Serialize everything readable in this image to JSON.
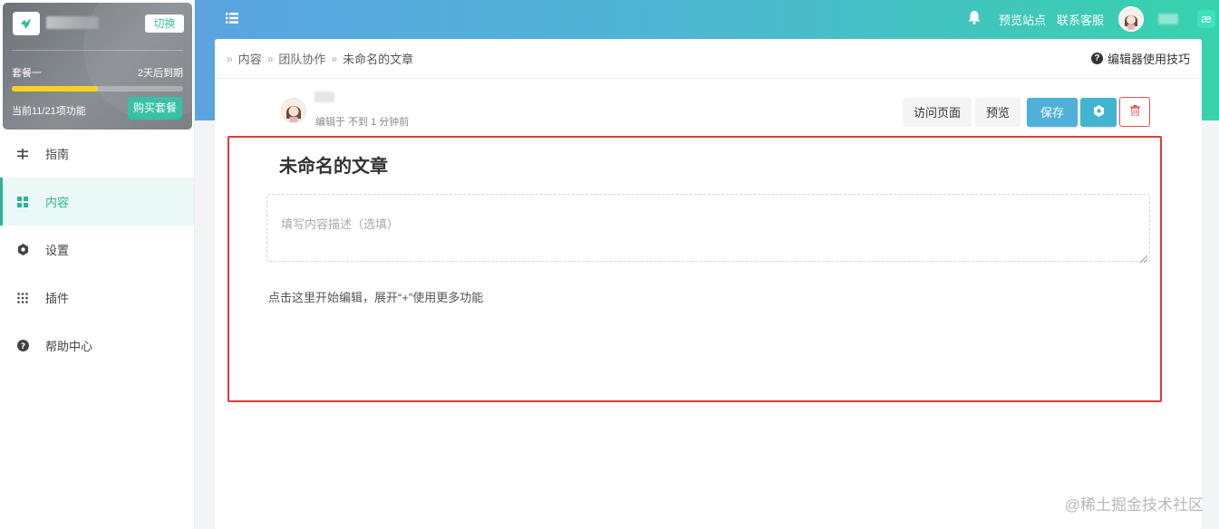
{
  "account": {
    "switch_label": "切换",
    "plan_name": "套餐一",
    "expire_text": "2天后到期",
    "usage_progress": 0.5,
    "feature_count": "当前11/21项功能",
    "buy_label": "购买套餐"
  },
  "sidebar": {
    "items": [
      {
        "label": "指南",
        "icon": "guide-icon",
        "active": false
      },
      {
        "label": "内容",
        "icon": "grid-icon",
        "active": true
      },
      {
        "label": "设置",
        "icon": "settings-icon",
        "active": false
      },
      {
        "label": "插件",
        "icon": "plugins-icon",
        "active": false
      },
      {
        "label": "帮助中心",
        "icon": "help-icon",
        "active": false
      }
    ]
  },
  "header": {
    "preview_site": "预览站点",
    "contact_service": "联系客服",
    "brand_badge": "æ"
  },
  "breadcrumb": {
    "items": [
      "内容",
      "团队协作",
      "未命名的文章"
    ]
  },
  "tips_label": "编辑器使用技巧",
  "editor": {
    "edited_meta": "编辑于 不到 1 分钟前",
    "visit_page": "访问页面",
    "preview": "预览",
    "save": "保存",
    "title": "未命名的文章",
    "description_placeholder": "填写内容描述（选填）",
    "hint": "点击这里开始编辑，展开“+”使用更多功能"
  },
  "watermark": "@稀土掘金技术社区",
  "colors": {
    "accent": "#2bb596",
    "header_gradient_start": "#5aa3e0",
    "header_gradient_end": "#37d2ac",
    "save_button": "#4fb0d9",
    "highlight_frame": "#e53935",
    "progress": "#f7d320"
  }
}
